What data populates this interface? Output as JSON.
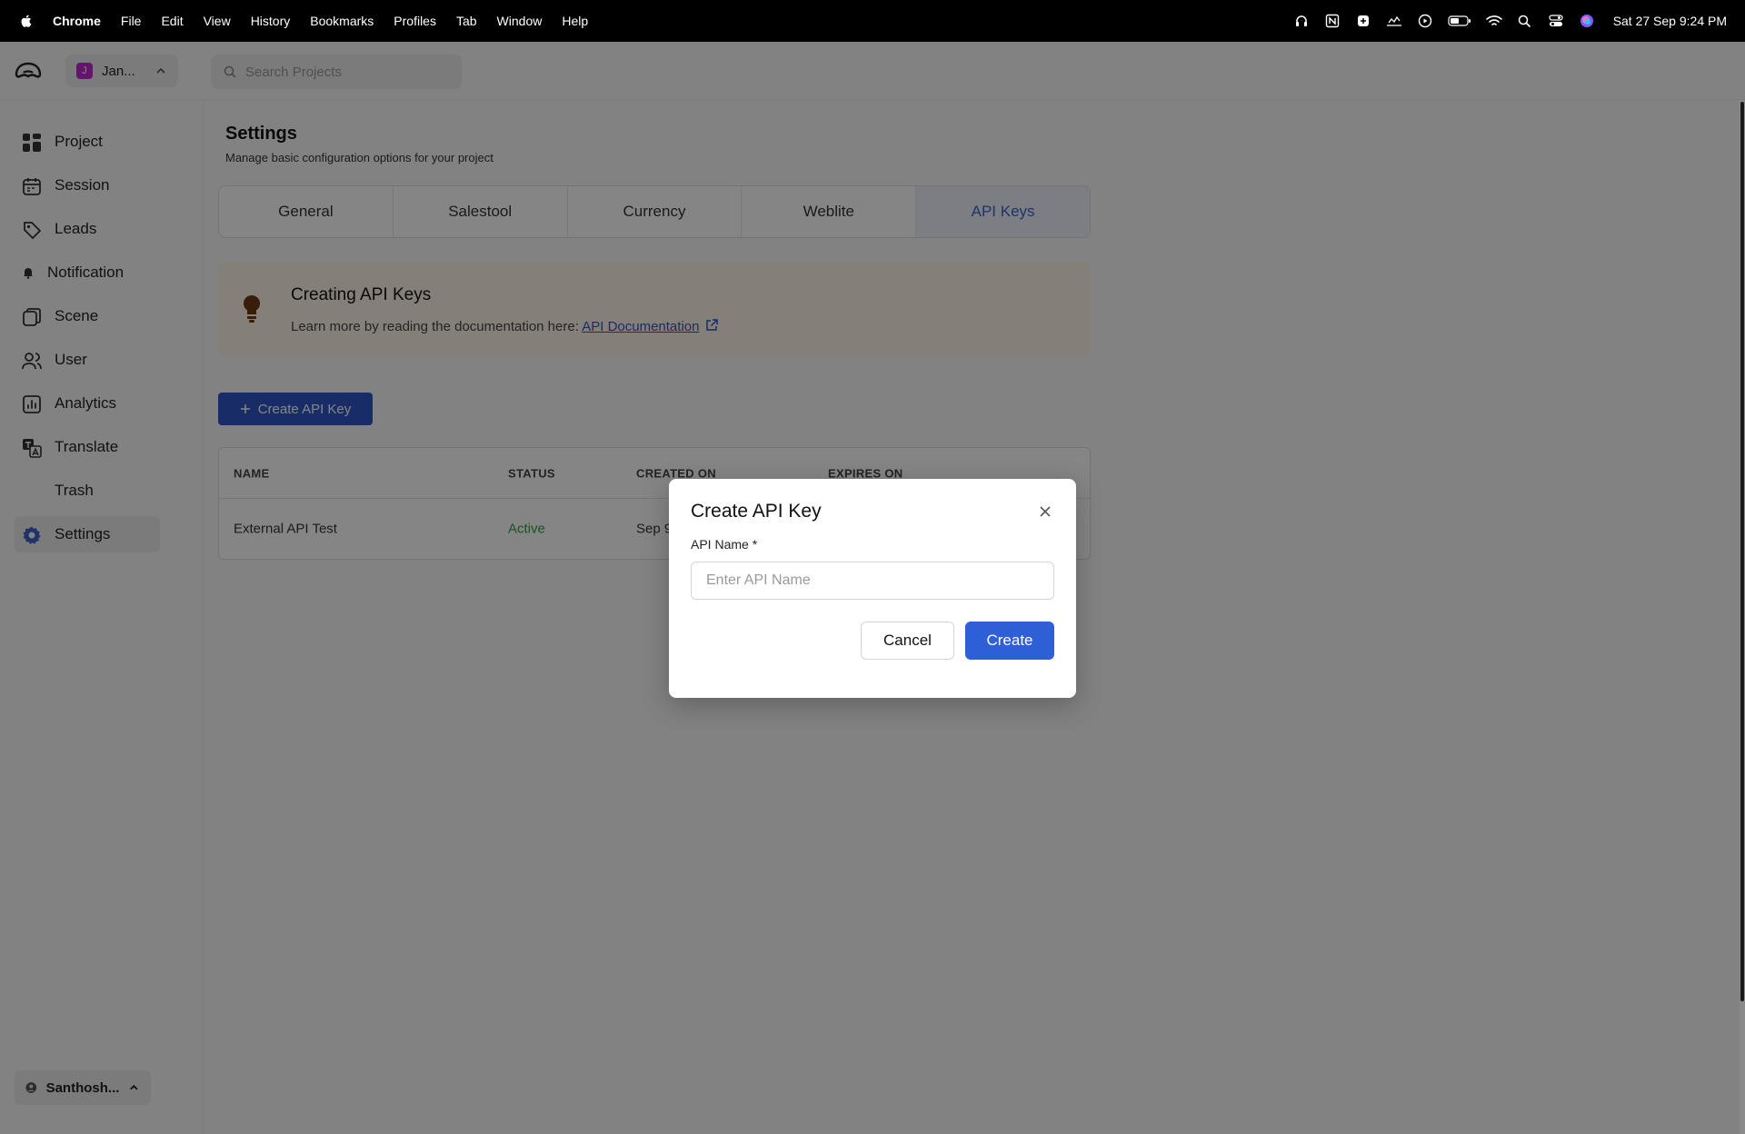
{
  "menubar": {
    "app_name": "Chrome",
    "items": [
      "File",
      "Edit",
      "View",
      "History",
      "Bookmarks",
      "Profiles",
      "Tab",
      "Window",
      "Help"
    ],
    "clock": "Sat 27 Sep  9:24 PM"
  },
  "topbar": {
    "project_name": "Jan...",
    "project_initial": "J",
    "search_placeholder": "Search Projects"
  },
  "sidebar": {
    "items": [
      {
        "label": "Project",
        "icon": "grid-icon"
      },
      {
        "label": "Session",
        "icon": "calendar-icon"
      },
      {
        "label": "Leads",
        "icon": "tag-icon"
      },
      {
        "label": "Notification",
        "icon": "bell-icon"
      },
      {
        "label": "Scene",
        "icon": "layers-icon"
      },
      {
        "label": "User",
        "icon": "users-icon"
      },
      {
        "label": "Analytics",
        "icon": "chart-icon"
      },
      {
        "label": "Translate",
        "icon": "translate-icon"
      },
      {
        "label": "Trash",
        "icon": ""
      },
      {
        "label": "Settings",
        "icon": "gear-icon"
      }
    ],
    "active": "Settings",
    "user_name": "Santhosh..."
  },
  "main": {
    "title": "Settings",
    "subtitle": "Manage basic configuration options for your project",
    "tabs": [
      {
        "label": "General"
      },
      {
        "label": "Salestool"
      },
      {
        "label": "Currency"
      },
      {
        "label": "Weblite"
      },
      {
        "label": "API Keys"
      }
    ],
    "active_tab": "API Keys",
    "callout": {
      "title": "Creating API Keys",
      "text": "Learn more by reading the documentation here: ",
      "link": "API Documentation"
    },
    "create_button": "Create API Key",
    "table": {
      "headers": [
        "NAME",
        "STATUS",
        "CREATED ON",
        "EXPIRES ON"
      ],
      "rows": [
        {
          "name": "External API Test",
          "status": "Active",
          "created": "Sep 9"
        }
      ]
    }
  },
  "modal": {
    "title": "Create API Key",
    "label": "API Name *",
    "placeholder": "Enter API Name",
    "value": "",
    "cancel": "Cancel",
    "create": "Create"
  },
  "colors": {
    "primary": "#2f5fd6",
    "active_status": "#2f9e44",
    "callout_bg": "#fdf3e8",
    "tab_active_text": "#3b63c8"
  }
}
